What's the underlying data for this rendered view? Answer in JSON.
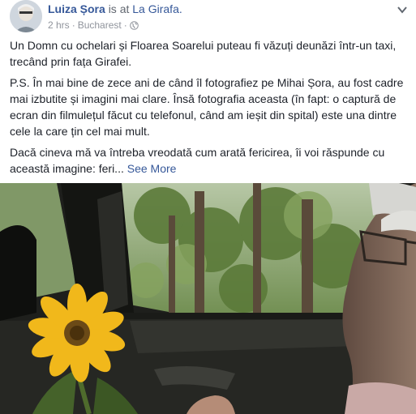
{
  "post": {
    "author": "Luiza Șora",
    "checkin_verb": "is at",
    "place": "La Girafa.",
    "time": "2 hrs",
    "separator": "·",
    "location": "Bucharest",
    "separator2": "·",
    "privacy_icon": "globe-icon",
    "menu_icon": "chevron-down-icon",
    "paragraphs": [
      "Un Domn cu ochelari și Floarea Soarelui puteau fi văzuți deunăzi într-un taxi, trecând prin fața Girafei.",
      "P.S. În mai bine de zece ani de când îl fotografiez pe Mihai Șora, au fost cadre mai izbutite și imagini mai clare. Însă fotografia aceasta (în fapt: o captură de ecran din filmulețul făcut cu telefonul, când am ieșit din spital) este una dintre cele la care țin cel mai mult.",
      "Dacă cineva mă va întreba vreodată cum arată fericirea, îi voi răspunde cu această imagine: feri..."
    ],
    "see_more": "See More"
  },
  "colors": {
    "link": "#365899",
    "text": "#1d2129",
    "meta": "#90949c"
  }
}
